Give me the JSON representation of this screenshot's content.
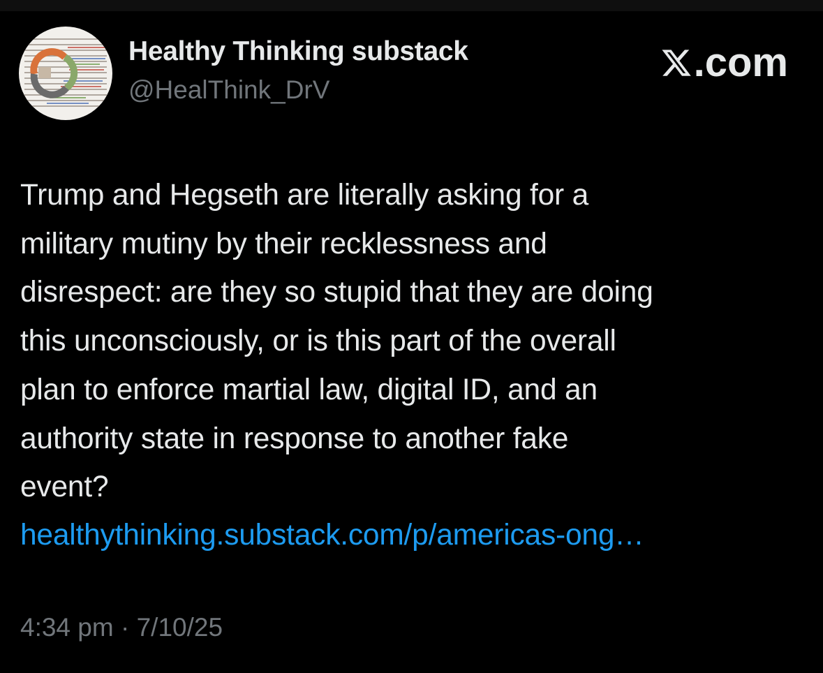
{
  "author": {
    "display_name": "Healthy Thinking substack",
    "handle": "@HealThink_DrV",
    "avatar_icon": "avatar-collage-icon"
  },
  "brand": {
    "icon": "x-logo-icon",
    "label": ".com"
  },
  "tweet": {
    "lines": [
      "Trump and Hegseth are literally asking for a",
      "military mutiny by their recklessness and",
      "disrespect: are they so stupid that they are doing",
      "this unconsciously, or is this part of the overall",
      "plan to enforce martial law, digital ID, and an",
      "authority state in response to another fake",
      "event?"
    ],
    "link": "healthythinking.substack.com/p/americas-ong…"
  },
  "meta": {
    "time": "4:34 pm",
    "separator": " · ",
    "date": "7/10/25"
  },
  "colors": {
    "background": "#000000",
    "text": "#e7e9ea",
    "secondary": "#71767b",
    "link": "#1d9bf0"
  }
}
